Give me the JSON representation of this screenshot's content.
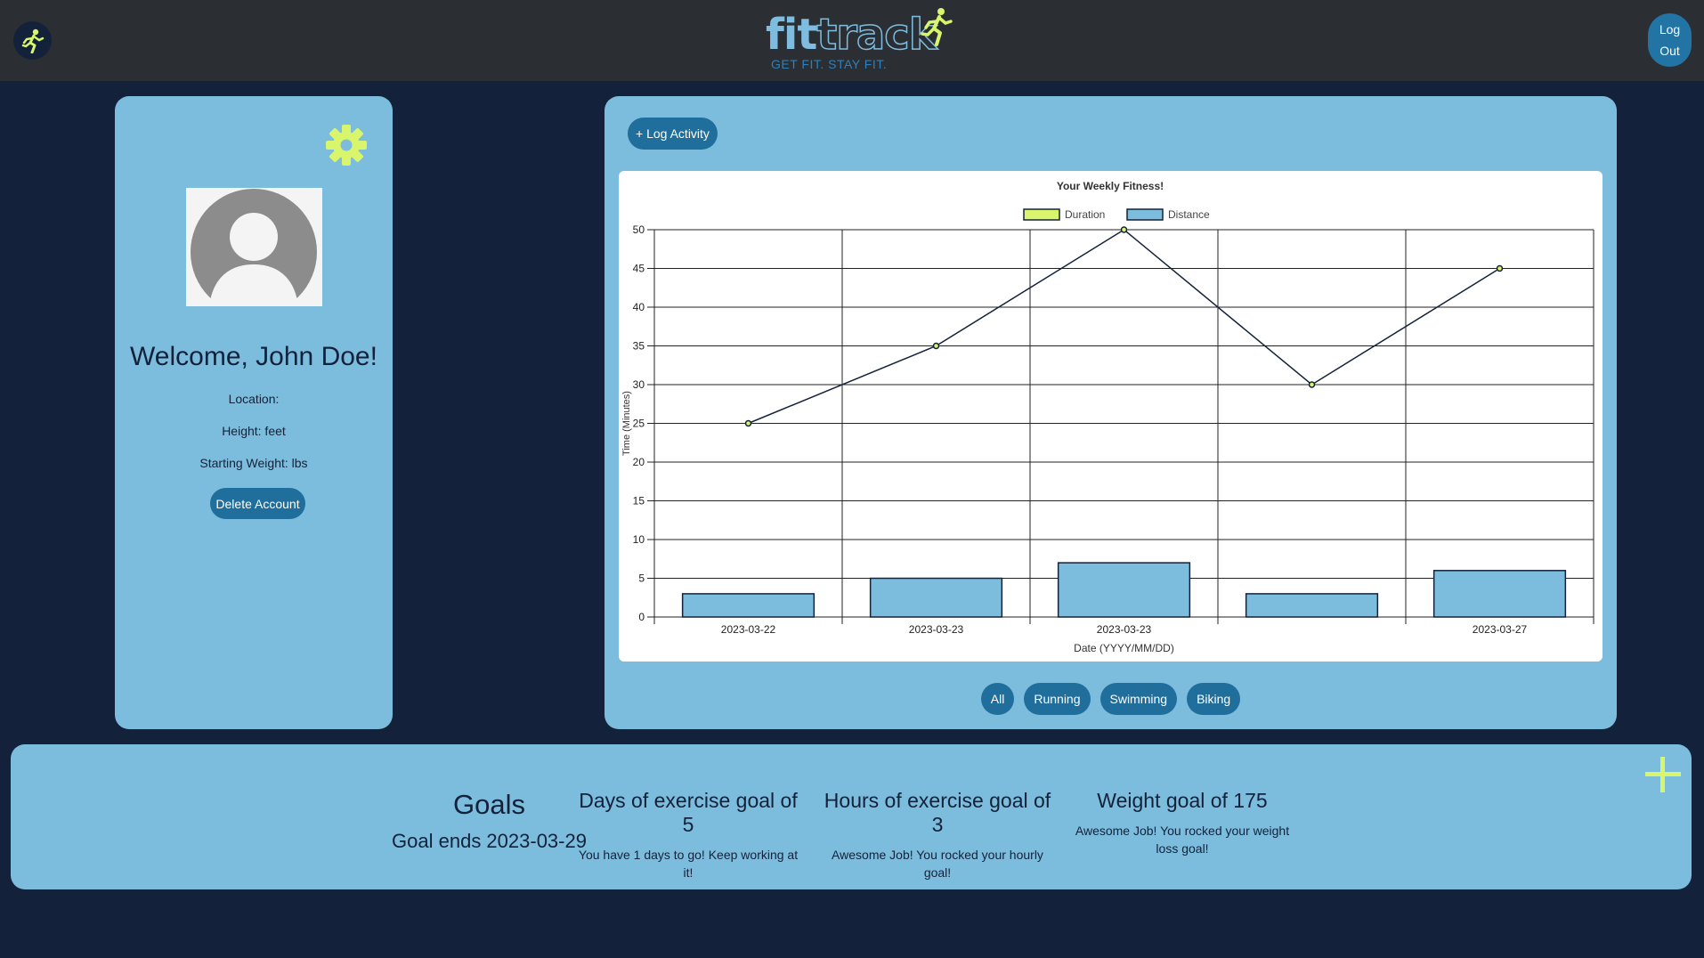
{
  "header": {
    "logo_fit": "fit",
    "logo_track": "track",
    "tagline": "GET FIT. STAY FIT.",
    "logout_line1": "Log",
    "logout_line2": "Out"
  },
  "profile": {
    "welcome": "Welcome, John Doe!",
    "location": "Location:",
    "height": "Height: feet",
    "starting_weight": "Starting Weight: lbs",
    "delete_label": "Delete Account"
  },
  "activity": {
    "log_label": "+ Log Activity",
    "filters": [
      "All",
      "Running",
      "Swimming",
      "Biking"
    ]
  },
  "chart_data": {
    "type": "bar",
    "title": "Your Weekly Fitness!",
    "xlabel": "Date (YYYY/MM/DD)",
    "ylabel": "Time (Minutes)",
    "ylim": [
      0,
      50
    ],
    "yticks": [
      0,
      5,
      10,
      15,
      20,
      25,
      30,
      35,
      40,
      45,
      50
    ],
    "categories": [
      "2023-03-22",
      "2023-03-23",
      "2023-03-23",
      "",
      "2023-03-27"
    ],
    "legend_position": "top",
    "grid": true,
    "series": [
      {
        "name": "Duration",
        "type": "line",
        "values": [
          25,
          35,
          50,
          30,
          45
        ],
        "color": "#d9f56b"
      },
      {
        "name": "Distance",
        "type": "bar",
        "values": [
          3,
          5,
          7,
          3,
          6
        ],
        "color": "#7cbcdd"
      }
    ]
  },
  "goals": {
    "title": "Goals",
    "ends": "Goal ends 2023-03-29",
    "items": [
      {
        "title": "Days of exercise goal of 5",
        "message": "You have 1 days to go! Keep working at it!"
      },
      {
        "title": "Hours of exercise goal of 3",
        "message": "Awesome Job! You rocked your hourly goal!"
      },
      {
        "title": "Weight goal of 175",
        "message": "Awesome Job! You rocked your weight loss goal!"
      }
    ]
  },
  "colors": {
    "background": "#13223a",
    "topbar": "#2b2f33",
    "card": "#7cbcdd",
    "button": "#1f6e9b",
    "accent": "#d9f56b"
  },
  "icons": {
    "home": "runner-icon",
    "settings": "gear-icon",
    "avatar": "user-silhouette-icon",
    "add_goal": "plus-icon"
  }
}
